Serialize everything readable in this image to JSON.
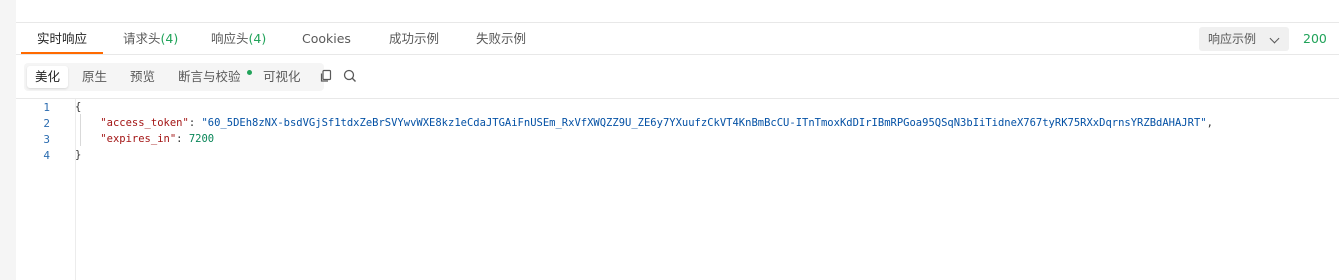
{
  "tabs": [
    {
      "label": "实时响应",
      "count": ""
    },
    {
      "label": "请求头",
      "count": "(4)"
    },
    {
      "label": "响应头",
      "count": "(4)"
    },
    {
      "label": "Cookies",
      "count": ""
    },
    {
      "label": "成功示例",
      "count": ""
    },
    {
      "label": "失败示例",
      "count": ""
    }
  ],
  "example_select": {
    "label": "响应示例"
  },
  "status_code": "200",
  "view_modes": [
    "美化",
    "原生",
    "预览",
    "断言与校验",
    "可视化"
  ],
  "icons": {
    "copy": "copy-icon",
    "search": "search-icon",
    "dropdown": "chevron-down-icon"
  },
  "colors": {
    "accent": "#ff6a00",
    "success": "#21a35a"
  },
  "code": {
    "line_numbers": [
      "1",
      "2",
      "3",
      "4"
    ],
    "open_brace": "{",
    "close_brace": "}",
    "access_token_key": "\"access_token\"",
    "access_token_value": "\"60_5DEh8zNX-bsdVGjSf1tdxZeBrSVYwvWXE8kz1eCdaJTGAiFnUSEm_RxVfXWQZZ9U_ZE6y7YXuufzCkVT4KnBmBcCU-ITnTmoxKdDIrIBmRPGoa95QSqN3bIiTidneX767tyRK75RXxDqrnsYRZBdAHAJRT\"",
    "expires_in_key": "\"expires_in\"",
    "expires_in_value": "7200",
    "colon": ": ",
    "comma": ","
  }
}
